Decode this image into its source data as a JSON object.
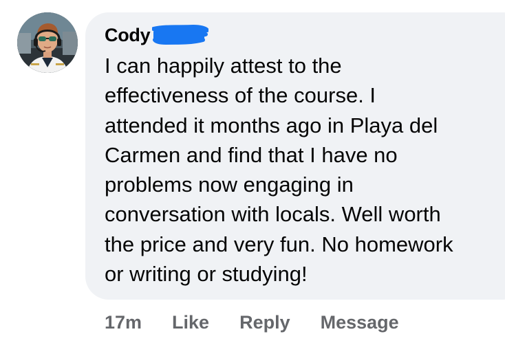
{
  "comment": {
    "author": {
      "name": "Cody"
    },
    "text": "I can happily attest to the\neffectiveness of the course. I\nattended it months ago in Playa del\nCarmen and find that I have no\nproblems now engaging in\nconversation with locals. Well worth\nthe price and very fun. No homework\nor writing or studying!",
    "timestamp": "17m",
    "actions": {
      "like": "Like",
      "reply": "Reply",
      "message": "Message"
    }
  },
  "colors": {
    "bubble": "#f0f2f5",
    "text": "#050505",
    "secondary_text": "#65676b",
    "redaction": "#1877f2"
  },
  "icons": {
    "avatar": "profile-photo-pilot"
  }
}
